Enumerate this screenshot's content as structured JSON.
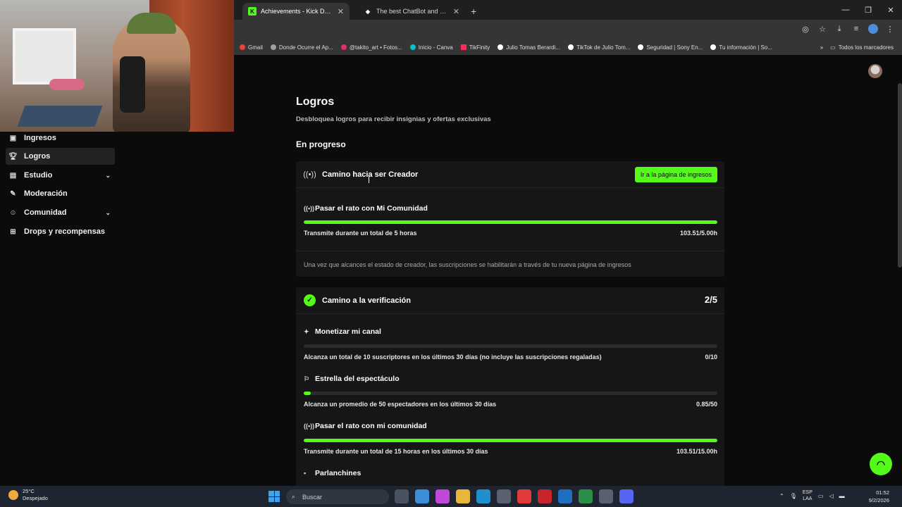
{
  "browser": {
    "tabs": [
      {
        "title": "Achievements - Kick Dashboard",
        "favicon": "K",
        "color": "#53fc18",
        "active": true
      },
      {
        "title": "The best ChatBot and Widgets",
        "favicon": "◆",
        "color": "#ffffff",
        "active": false
      }
    ],
    "bookmarks": [
      {
        "label": "Gmail",
        "color": "#ea4335"
      },
      {
        "label": "Donde Ocurre el Ap...",
        "color": "#9aa0a6"
      },
      {
        "label": "@takito_art • Fotos...",
        "color": "#e1306c"
      },
      {
        "label": "Inicio - Canva",
        "color": "#00c4cc"
      },
      {
        "label": "TikFinity",
        "color": "#ff2d55"
      },
      {
        "label": "Julio Tomas Berardi...",
        "color": "#ffffff"
      },
      {
        "label": "TikTok de Julio Tom...",
        "color": "#ffffff"
      },
      {
        "label": "Seguridad | Sony En...",
        "color": "#ffffff"
      },
      {
        "label": "Tu información | So...",
        "color": "#ffffff"
      }
    ],
    "bookmarks_all": "Todos los marcadores"
  },
  "sidebar": {
    "items": [
      {
        "label": "Ingresos",
        "icon": "money-icon",
        "glyph": "▣",
        "active": false,
        "chevron": false
      },
      {
        "label": "Logros",
        "icon": "trophy-icon",
        "glyph": "🏆︎",
        "active": true,
        "chevron": false
      },
      {
        "label": "Estudio",
        "icon": "studio-icon",
        "glyph": "▤",
        "active": false,
        "chevron": true
      },
      {
        "label": "Moderación",
        "icon": "wrench-icon",
        "glyph": "✎",
        "active": false,
        "chevron": false
      },
      {
        "label": "Comunidad",
        "icon": "community-icon",
        "glyph": "☺",
        "active": false,
        "chevron": true
      },
      {
        "label": "Drops y recompensas",
        "icon": "drops-icon",
        "glyph": "⊞",
        "active": false,
        "chevron": false
      }
    ]
  },
  "main": {
    "title": "Logros",
    "subtitle": "Desbloquea logros para recibir insignias y ofertas exclusivas",
    "section": "En progreso",
    "card1": {
      "title": "Camino hacia ser Creador",
      "button": "Ir a la página de ingresos",
      "achievement": {
        "name": "Pasar el rato con Mi Comunidad",
        "desc": "Transmite durante un total de 5 horas",
        "value": "103.51/5.00h",
        "progress": 1.0
      },
      "note": "Una vez que alcances el estado de creador, las suscripciones se habilitarán a través de tu nueva página de ingresos"
    },
    "card2": {
      "title": "Camino a la verificación",
      "count": "2/5",
      "achievements": [
        {
          "name": "Monetizar mi canal",
          "glyph": "✦",
          "desc": "Alcanza un total de 10 suscriptores en los últimos 30 días (no incluye las suscripciones regaladas)",
          "value": "0/10",
          "progress": 0.0
        },
        {
          "name": "Estrella del espectáculo",
          "glyph": "⚐",
          "desc": "Alcanza un promedio de 50 espectadores en los últimos 30 días",
          "value": "0.85/50",
          "progress": 0.017
        },
        {
          "name": "Pasar el rato con mi comunidad",
          "glyph": "((•))",
          "desc": "Transmite durante un total de 15 horas en los últimos 30 días",
          "value": "103.51/15.00h",
          "progress": 1.0
        },
        {
          "name": "Parlanchines",
          "glyph": "▪",
          "desc": "",
          "value": "",
          "progress": null
        }
      ]
    }
  },
  "taskbar": {
    "temp": "25°C",
    "weather": "Despejado",
    "search_placeholder": "Buscar",
    "lang1": "ESP",
    "lang2": "LAA",
    "time": "01:52",
    "date": "9/2/2026"
  }
}
